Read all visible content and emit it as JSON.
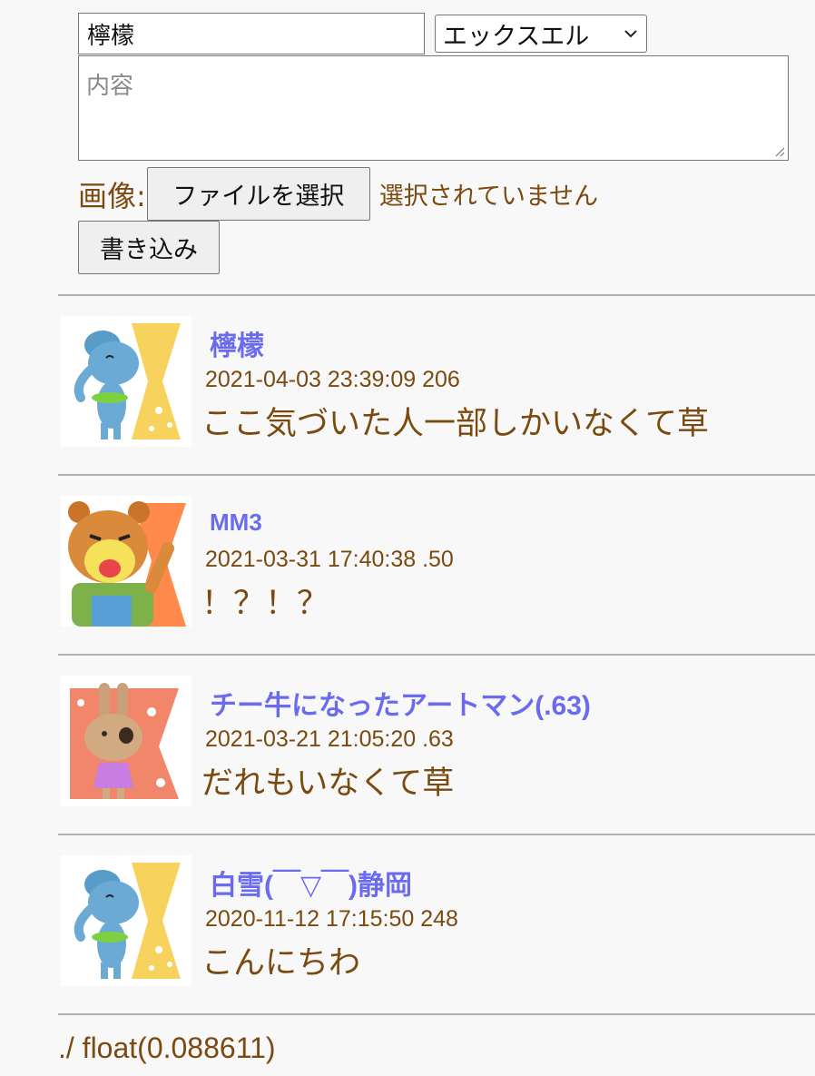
{
  "form": {
    "name_value": "檸檬",
    "select_value": "エックスエル",
    "content_placeholder": "内容",
    "image_label": "画像:",
    "file_button": "ファイルを選択",
    "file_status": "選択されていません",
    "submit_label": "書き込み"
  },
  "posts": [
    {
      "name": "檸檬",
      "meta": "2021-04-03 23:39:09 206",
      "body": "ここ気づいた人一部しかいなくて草",
      "avatar": "blue-elephant-avatar-icon"
    },
    {
      "name": "MM3",
      "meta": "2021-03-31 17:40:38 .50",
      "body": "！？！？",
      "avatar": "bear-cub-avatar-icon"
    },
    {
      "name": "チー牛になったアートマン(.63)",
      "meta": "2021-03-21 21:05:20 .63",
      "body": "だれもいなくて草",
      "avatar": "rabbit-avatar-icon"
    },
    {
      "name": "白雪(￣▽￣)静岡",
      "meta": "2020-11-12 17:15:50 248",
      "body": "こんにちわ",
      "avatar": "blue-elephant-avatar-icon"
    }
  ],
  "footer": "./ float(0.088611)",
  "colors": {
    "name": "#6b6bf0",
    "text": "#7a4a10",
    "divider": "#b0b0b0"
  }
}
